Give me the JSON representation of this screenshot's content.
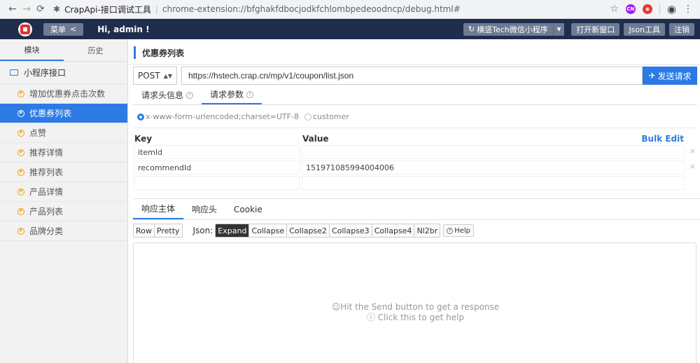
{
  "browser": {
    "tab_title": "CrapApi-接口调试工具",
    "url": "chrome-extension://bfghakfdbocjodkfchlombpedeoodncp/debug.html#",
    "icons": [
      "back-icon",
      "forward-icon",
      "reload-icon",
      "extension-icon",
      "star-icon",
      "account-icon",
      "more-icon"
    ],
    "ext_labels": {
      "cn": "CN",
      "red": "◉"
    }
  },
  "header": {
    "menu_label": "菜单",
    "menu_chevron": "<",
    "greeting": "Hi, admin !",
    "miniprogram_label": "横竖Tech微信小程序",
    "miniprogram_icon": "↻",
    "caret": "▾",
    "open_new_window": "打开新窗口",
    "json_tool": "Json工具",
    "logout": "注销",
    "colors": {
      "bg": "#1f2d4d",
      "button": "#6d7a93",
      "logo": "#e2312d"
    }
  },
  "sidebar": {
    "tabs": [
      {
        "label": "模块",
        "active": true
      },
      {
        "label": "历史",
        "active": false
      }
    ],
    "group_label": "小程序接口",
    "item_icon": "P",
    "items": [
      {
        "label": "增加优惠券点击次数",
        "active": false
      },
      {
        "label": "优惠券列表",
        "active": true
      },
      {
        "label": "点赞",
        "active": false
      },
      {
        "label": "推荐详情",
        "active": false
      },
      {
        "label": "推荐列表",
        "active": false
      },
      {
        "label": "产品详情",
        "active": false
      },
      {
        "label": "产品列表",
        "active": false
      },
      {
        "label": "品牌分类",
        "active": false
      }
    ]
  },
  "main": {
    "title": "优惠券列表",
    "method": "POST",
    "method_arrows": "▲▼",
    "url": "https://hstech.crap.cn/mp/v1/coupon/list.json",
    "send_icon": "✈",
    "send_label": "发送请求",
    "param_tabs": [
      {
        "label": "请求头信息",
        "active": false
      },
      {
        "label": "请求参数",
        "active": true
      }
    ],
    "question_glyph": "?",
    "content_types": [
      {
        "label": "x-www-form-urlencoded;charset=UTF-8",
        "selected": true
      },
      {
        "label": "customer",
        "selected": false
      }
    ],
    "kv": {
      "key_header": "Key",
      "value_header": "Value",
      "bulk_edit": "Bulk Edit",
      "remove_glyph": "×",
      "rows": [
        {
          "key": "itemId",
          "value": ""
        },
        {
          "key": "recommendId",
          "value": "151971085994004006"
        },
        {
          "key": "",
          "value": ""
        }
      ]
    },
    "response_tabs": [
      {
        "label": "响应主体",
        "active": true
      },
      {
        "label": "响应头",
        "active": false
      },
      {
        "label": "Cookie",
        "active": false
      }
    ],
    "view_buttons": [
      "Row",
      "Pretty"
    ],
    "json_label": "Json:",
    "json_buttons": [
      "Expand",
      "Collapse",
      "Collapse2",
      "Collapse3",
      "Collapse4",
      "Nl2br"
    ],
    "json_active": "Expand",
    "help_label": "Help",
    "response_message": "☺Hit the Send button to get a response",
    "help_message": "ⓘ Click this to get help"
  }
}
